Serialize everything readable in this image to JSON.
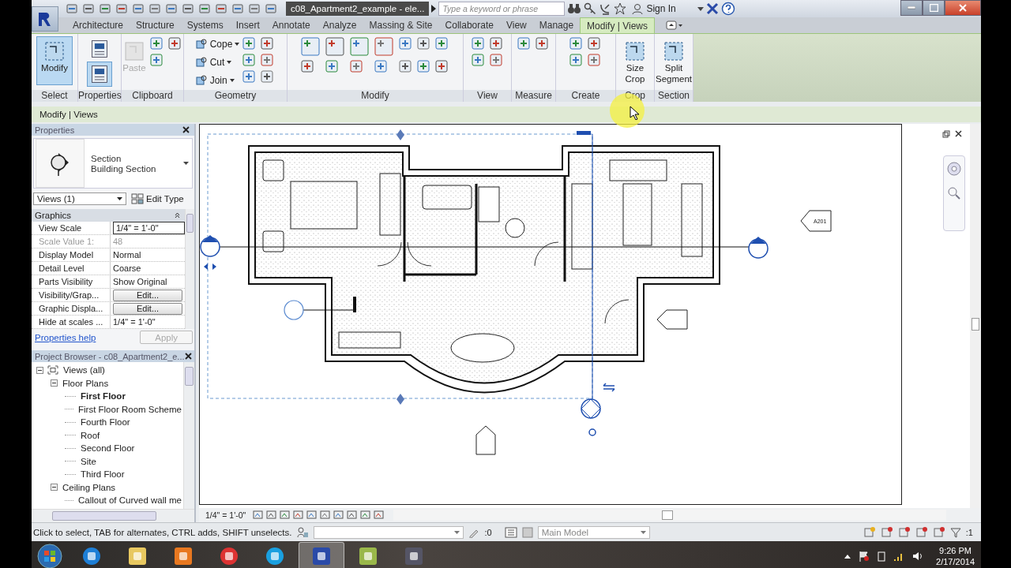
{
  "title_bar": {
    "title": "c08_Apartment2_example - ele...",
    "search": {
      "placeholder": "Type a keyword or phrase"
    },
    "sign_in": "Sign In"
  },
  "tabs": [
    {
      "label": "Architecture",
      "selected": false
    },
    {
      "label": "Structure",
      "selected": false
    },
    {
      "label": "Systems",
      "selected": false
    },
    {
      "label": "Insert",
      "selected": false
    },
    {
      "label": "Annotate",
      "selected": false
    },
    {
      "label": "Analyze",
      "selected": false
    },
    {
      "label": "Massing & Site",
      "selected": false
    },
    {
      "label": "Collaborate",
      "selected": false
    },
    {
      "label": "View",
      "selected": false
    },
    {
      "label": "Manage",
      "selected": false
    },
    {
      "label": "Modify | Views",
      "selected": true
    }
  ],
  "ribbon_panels": [
    {
      "label": "Select",
      "tools": [
        {
          "label": "Modify",
          "kind": "large",
          "selected": true
        }
      ]
    },
    {
      "label": "Properties",
      "tools": [
        {
          "kind": "icon-large",
          "selected": false
        },
        {
          "kind": "icon-large",
          "selected": true
        }
      ]
    },
    {
      "label": "Clipboard",
      "tools": [
        {
          "label": "Paste",
          "kind": "large",
          "disabled": true
        }
      ]
    },
    {
      "label": "Geometry",
      "tools": [
        {
          "label": "Cope",
          "kind": "small"
        },
        {
          "label": "Cut",
          "kind": "small"
        },
        {
          "label": "Join",
          "kind": "small"
        }
      ]
    },
    {
      "label": "Modify"
    },
    {
      "label": "View"
    },
    {
      "label": "Measure"
    },
    {
      "label": "Create"
    },
    {
      "label": "Crop",
      "tools": [
        {
          "label": "Size Crop",
          "kind": "large"
        }
      ]
    },
    {
      "label": "Section",
      "tools": [
        {
          "label": "Split Segment",
          "kind": "large"
        }
      ]
    }
  ],
  "context_bar": "Modify | Views",
  "properties": {
    "title": "Properties",
    "type_name": "Section",
    "type_family": "Building Section",
    "instance_filter": "Views (1)",
    "edit_type": "Edit Type",
    "group": "Graphics",
    "rows": [
      {
        "name": "View Scale",
        "value": "1/4\" = 1'-0\"",
        "kind": "input"
      },
      {
        "name": "Scale Value    1:",
        "value": "48",
        "kind": "readonly"
      },
      {
        "name": "Display Model",
        "value": "Normal",
        "kind": "text"
      },
      {
        "name": "Detail Level",
        "value": "Coarse",
        "kind": "text"
      },
      {
        "name": "Parts Visibility",
        "value": "Show Original",
        "kind": "text"
      },
      {
        "name": "Visibility/Grap...",
        "value": "Edit...",
        "kind": "button"
      },
      {
        "name": "Graphic Displa...",
        "value": "Edit...",
        "kind": "button"
      },
      {
        "name": "Hide at scales ...",
        "value": "1/4\" = 1'-0\"",
        "kind": "text"
      }
    ],
    "help": "Properties help",
    "apply": {
      "label": "Apply",
      "disabled": true
    }
  },
  "project_browser": {
    "title": "Project Browser - c08_Apartment2_e...",
    "tree": [
      {
        "label": "Views (all)",
        "expanded": true,
        "selected": false,
        "children": [
          {
            "label": "Floor Plans",
            "expanded": true,
            "selected": false,
            "children": [
              {
                "label": "First Floor",
                "selected": true
              },
              {
                "label": "First Floor Room Scheme",
                "selected": false
              },
              {
                "label": "Fourth Floor",
                "selected": false
              },
              {
                "label": "Roof",
                "selected": false
              },
              {
                "label": "Second Floor",
                "selected": false
              },
              {
                "label": "Site",
                "selected": false
              },
              {
                "label": "Third Floor",
                "selected": false
              }
            ]
          },
          {
            "label": "Ceiling Plans",
            "expanded": true,
            "selected": false,
            "children": [
              {
                "label": "Callout of Curved wall me",
                "selected": false
              }
            ]
          }
        ]
      }
    ]
  },
  "canvas": {
    "elevation_tag": "A201"
  },
  "view_control_bar": {
    "scale": "1/4\" = 1'-0\""
  },
  "status_bar": {
    "hint": "Click to select, TAB for alternates, CTRL adds, SHIFT unselects.",
    "editable_count": ":0",
    "model": "Main Model",
    "filter_count": ":1"
  },
  "taskbar": {
    "apps": [
      {
        "kind": "browser",
        "selected": false
      },
      {
        "kind": "folder",
        "selected": false
      },
      {
        "kind": "player",
        "selected": false
      },
      {
        "kind": "chrome",
        "selected": false
      },
      {
        "kind": "chat",
        "selected": false
      },
      {
        "kind": "revit",
        "selected": true
      },
      {
        "kind": "sheet",
        "selected": false
      },
      {
        "kind": "camera",
        "selected": false
      }
    ],
    "time": "9:26 PM",
    "date": "2/17/2014"
  }
}
